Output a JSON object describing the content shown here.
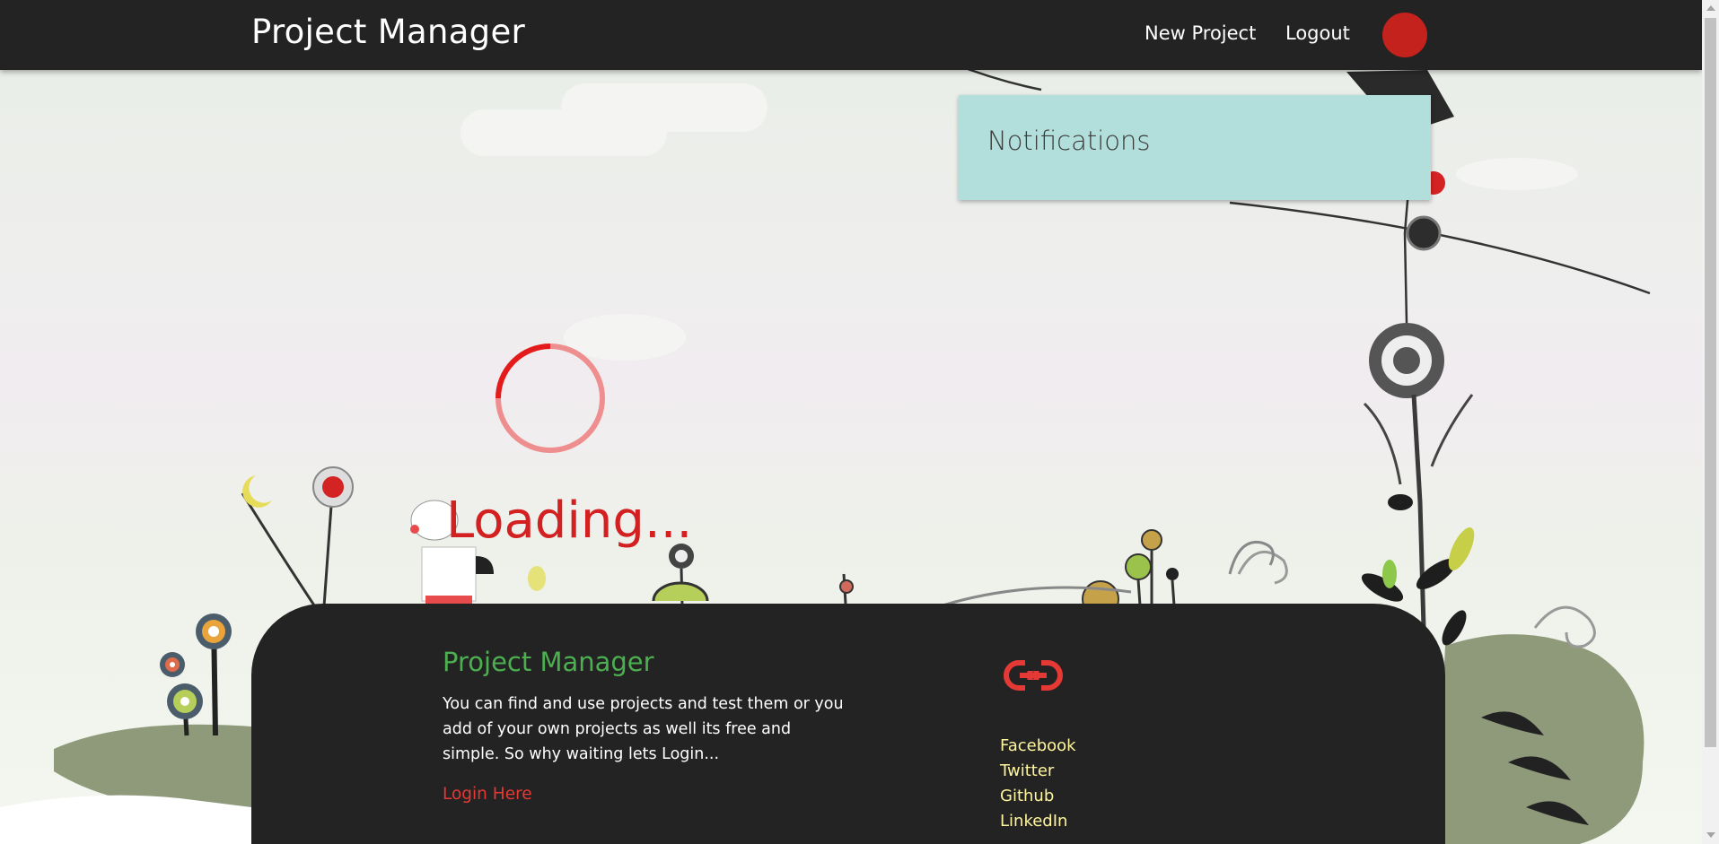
{
  "navbar": {
    "brand": "Project Manager",
    "links": [
      "New Project",
      "Logout"
    ]
  },
  "notifications": {
    "title": "Notifications"
  },
  "loader": {
    "text": "Loading..."
  },
  "footer": {
    "title": "Project Manager",
    "description": "You can find and use projects and test them or you add of your own projects as well its free and simple. So why waiting lets Login...",
    "login_link": "Login Here",
    "links_icon": "link-icon",
    "links": [
      "Facebook",
      "Twitter",
      "Github",
      "LinkedIn"
    ]
  },
  "colors": {
    "navbar_bg": "#232323",
    "avatar": "#c4221d",
    "notifications_bg": "#b2dfdb",
    "loader_red": "#d32020",
    "footer_title": "#4caf50",
    "footer_links": "#fff59d",
    "footer_login": "#e53935"
  }
}
